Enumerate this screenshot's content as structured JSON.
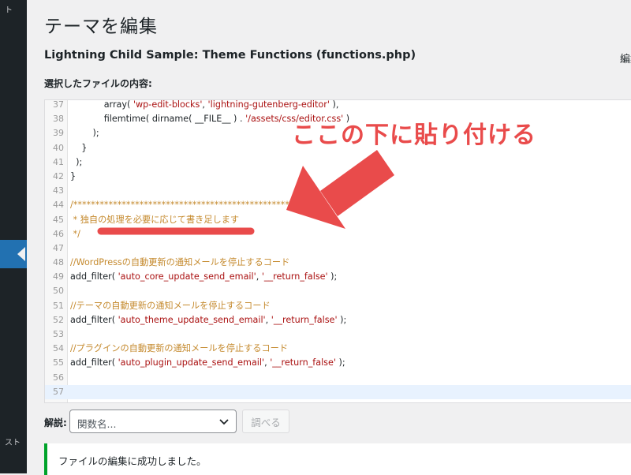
{
  "sidebar": {
    "top_fragment": "ト",
    "bottom_fragment": "スト"
  },
  "page_title": "テーマを編集",
  "file_heading": "Lightning Child Sample: Theme Functions (functions.php)",
  "right_fragment": "編集",
  "content_label": "選択したファイルの内容:",
  "editor": {
    "current_line": 57,
    "lines": [
      {
        "n": "37",
        "tokens": [
          {
            "c": "t-plain",
            "t": "            "
          },
          {
            "c": "t-fn",
            "t": "array"
          },
          {
            "c": "t-plain",
            "t": "( "
          },
          {
            "c": "t-string",
            "t": "'wp-edit-blocks'"
          },
          {
            "c": "t-plain",
            "t": ", "
          },
          {
            "c": "t-string",
            "t": "'lightning-gutenberg-editor'"
          },
          {
            "c": "t-plain",
            "t": " ),"
          }
        ]
      },
      {
        "n": "38",
        "tokens": [
          {
            "c": "t-plain",
            "t": "            "
          },
          {
            "c": "t-fn",
            "t": "filemtime"
          },
          {
            "c": "t-plain",
            "t": "( "
          },
          {
            "c": "t-fn",
            "t": "dirname"
          },
          {
            "c": "t-plain",
            "t": "( __FILE__ ) . "
          },
          {
            "c": "t-string",
            "t": "'/assets/css/editor.css'"
          },
          {
            "c": "t-plain",
            "t": " )"
          }
        ]
      },
      {
        "n": "39",
        "tokens": [
          {
            "c": "t-plain",
            "t": "        );"
          }
        ]
      },
      {
        "n": "40",
        "tokens": [
          {
            "c": "t-plain",
            "t": "    }"
          }
        ]
      },
      {
        "n": "41",
        "tokens": [
          {
            "c": "t-plain",
            "t": "  );"
          }
        ]
      },
      {
        "n": "42",
        "tokens": [
          {
            "c": "t-plain",
            "t": "}"
          }
        ]
      },
      {
        "n": "43",
        "tokens": []
      },
      {
        "n": "44",
        "tokens": [
          {
            "c": "t-comment",
            "t": "/*************************************************"
          }
        ]
      },
      {
        "n": "45",
        "tokens": [
          {
            "c": "t-comment",
            "t": " * 独自の処理を必要に応じて書き足します"
          }
        ]
      },
      {
        "n": "46",
        "tokens": [
          {
            "c": "t-comment",
            "t": " */"
          }
        ]
      },
      {
        "n": "47",
        "tokens": []
      },
      {
        "n": "48",
        "tokens": [
          {
            "c": "t-comment",
            "t": "//WordPressの自動更新の通知メールを停止するコード"
          }
        ]
      },
      {
        "n": "49",
        "tokens": [
          {
            "c": "t-fn",
            "t": "add_filter"
          },
          {
            "c": "t-plain",
            "t": "( "
          },
          {
            "c": "t-string",
            "t": "'auto_core_update_send_email'"
          },
          {
            "c": "t-plain",
            "t": ", "
          },
          {
            "c": "t-string",
            "t": "'__return_false'"
          },
          {
            "c": "t-plain",
            "t": " );"
          }
        ]
      },
      {
        "n": "50",
        "tokens": []
      },
      {
        "n": "51",
        "tokens": [
          {
            "c": "t-comment",
            "t": "//テーマの自動更新の通知メールを停止するコード"
          }
        ]
      },
      {
        "n": "52",
        "tokens": [
          {
            "c": "t-fn",
            "t": "add_filter"
          },
          {
            "c": "t-plain",
            "t": "( "
          },
          {
            "c": "t-string",
            "t": "'auto_theme_update_send_email'"
          },
          {
            "c": "t-plain",
            "t": ", "
          },
          {
            "c": "t-string",
            "t": "'__return_false'"
          },
          {
            "c": "t-plain",
            "t": " );"
          }
        ]
      },
      {
        "n": "53",
        "tokens": []
      },
      {
        "n": "54",
        "tokens": [
          {
            "c": "t-comment",
            "t": "//プラグインの自動更新の通知メールを停止するコード"
          }
        ]
      },
      {
        "n": "55",
        "tokens": [
          {
            "c": "t-fn",
            "t": "add_filter"
          },
          {
            "c": "t-plain",
            "t": "( "
          },
          {
            "c": "t-string",
            "t": "'auto_plugin_update_send_email'"
          },
          {
            "c": "t-plain",
            "t": ", "
          },
          {
            "c": "t-string",
            "t": "'__return_false'"
          },
          {
            "c": "t-plain",
            "t": " );"
          }
        ]
      },
      {
        "n": "56",
        "tokens": []
      },
      {
        "n": "57",
        "tokens": []
      }
    ]
  },
  "annotation_text": "ここの下に貼り付ける",
  "annotation_color": "#e94b4b",
  "doc_label": "解説:",
  "function_select": {
    "value": "関数名..."
  },
  "lookup_button_label": "調べる",
  "notice_text": "ファイルの編集に成功しました。",
  "colors": {
    "accent": "#2271b1",
    "success": "#00a32a"
  }
}
